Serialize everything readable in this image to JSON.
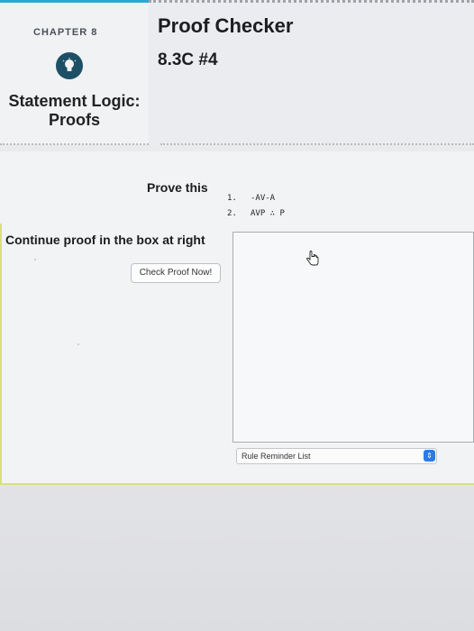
{
  "sidebar": {
    "chapter_label": "CHAPTER 8",
    "section_title_line1": "Statement Logic:",
    "section_title_line2": "Proofs"
  },
  "header": {
    "app_title": "Proof Checker",
    "problem_id": "8.3C #4"
  },
  "problem": {
    "prove_label": "Prove this",
    "premises": [
      {
        "num": "1.",
        "formula": "-AV-A"
      },
      {
        "num": "2.",
        "formula": "AVP ∴ P"
      }
    ]
  },
  "proof": {
    "instruction": "Continue proof in the box at right",
    "check_button_label": "Check Proof Now!",
    "rule_reminder_selected": "Rule Reminder List"
  },
  "colors": {
    "accent_blue": "#2aa9d6",
    "select_arrow_blue": "#2c7be5",
    "panel_border_yellow": "#d9e07a"
  },
  "icons": {
    "bulb": "lightbulb-icon",
    "cursor": "hand-pointer-icon",
    "select_arrow": "up-down-arrows-icon"
  }
}
